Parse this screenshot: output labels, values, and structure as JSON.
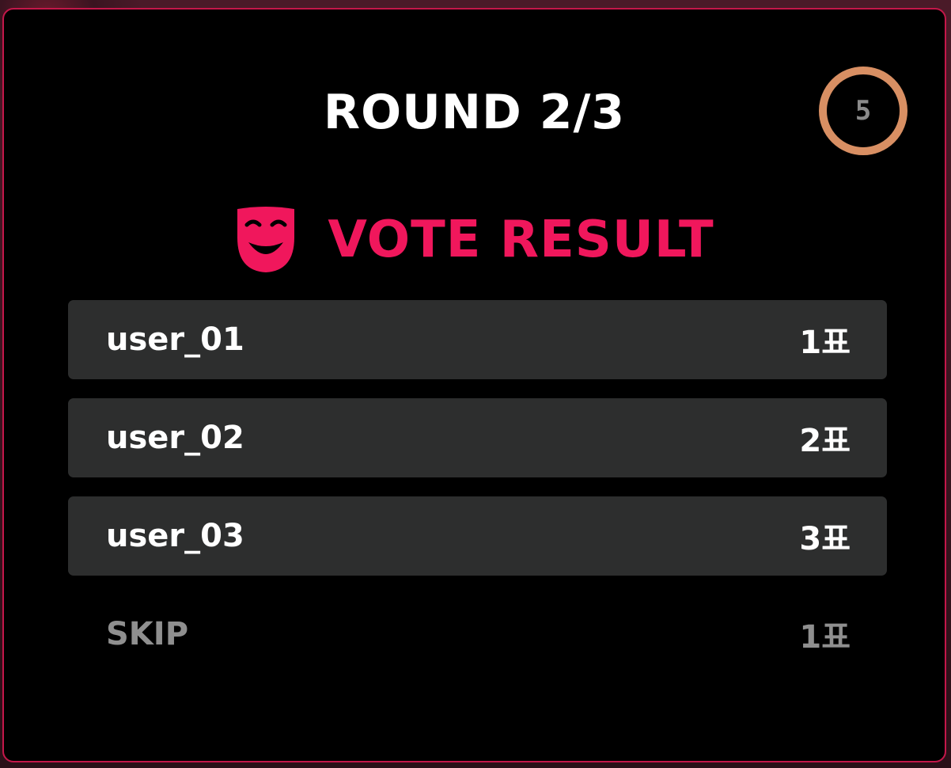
{
  "round": {
    "title": "ROUND 2/3"
  },
  "timer": {
    "value": "5"
  },
  "vote": {
    "title": "VOTE RESULT",
    "icon": "theater-mask-icon"
  },
  "results": [
    {
      "name": "user_01",
      "count": "1표"
    },
    {
      "name": "user_02",
      "count": "2표"
    },
    {
      "name": "user_03",
      "count": "3표"
    },
    {
      "name": "SKIP",
      "count": "1표"
    }
  ],
  "colors": {
    "accent": "#f0175c",
    "border": "#c4174a",
    "row_bg": "#2d2e2e",
    "timer_ring": "#d88f63",
    "muted": "#8f8f8f"
  }
}
